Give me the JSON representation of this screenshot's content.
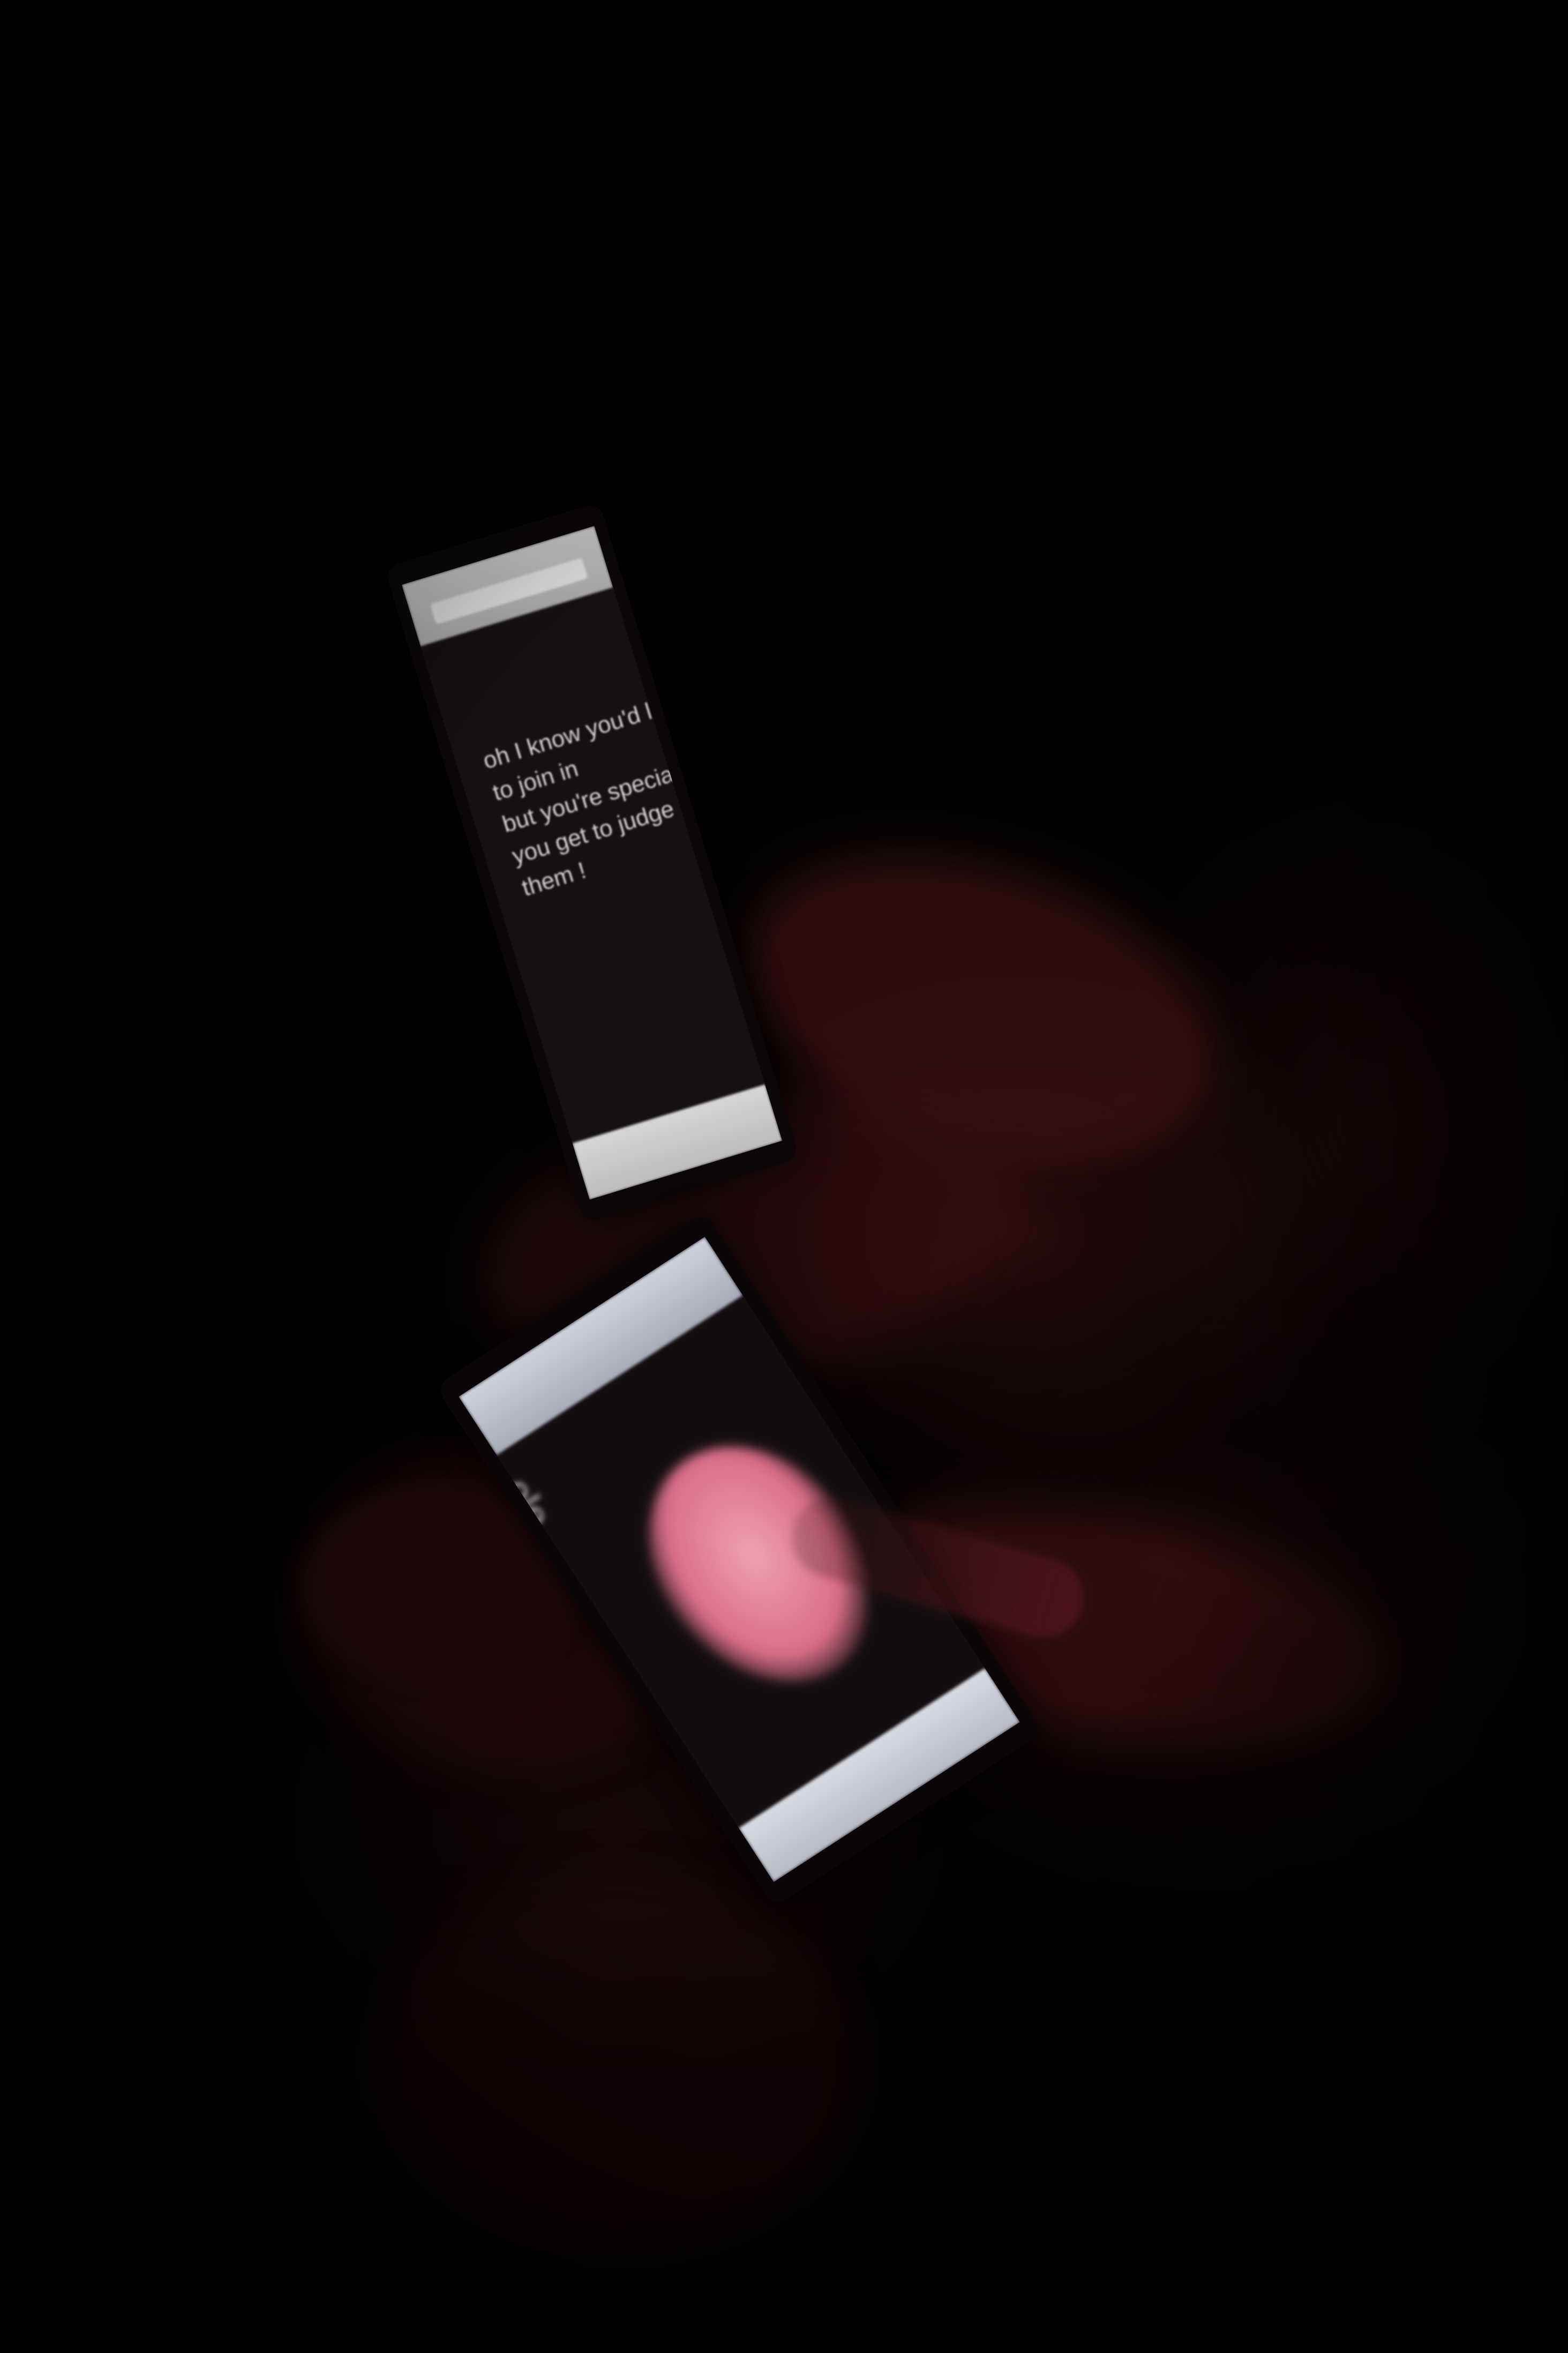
{
  "scene": {
    "description_colors": {
      "background": "#020101",
      "screen_glow": "#d8d4d2",
      "pink_image": "#d96e89"
    }
  },
  "top_phone": {
    "lyrics": [
      "oh I know you'd like",
      "to join in",
      "but you're special",
      "you get to judge",
      "them !"
    ]
  },
  "bottom_phone": {
    "blurred_text": "ole"
  }
}
